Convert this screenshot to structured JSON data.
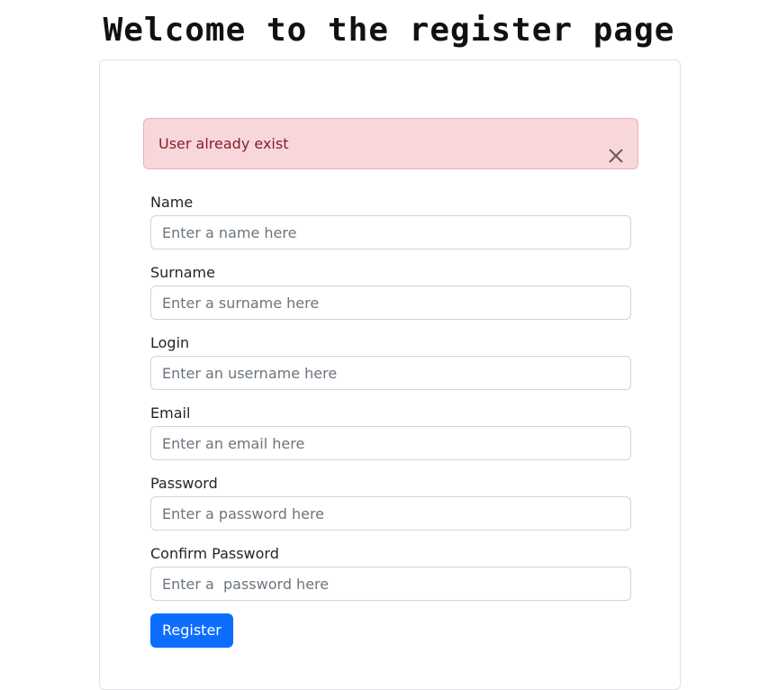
{
  "page": {
    "title": "Welcome to the register page"
  },
  "alert": {
    "message": "User already exist",
    "close_icon": "close-icon",
    "colors": {
      "background": "#f8d7da",
      "text": "#842029"
    }
  },
  "form": {
    "fields": [
      {
        "label": "Name",
        "placeholder": "Enter a name here",
        "value": ""
      },
      {
        "label": "Surname",
        "placeholder": "Enter a surname here",
        "value": ""
      },
      {
        "label": "Login",
        "placeholder": "Enter an username here",
        "value": ""
      },
      {
        "label": "Email",
        "placeholder": "Enter an email here",
        "value": ""
      },
      {
        "label": "Password",
        "placeholder": "Enter a password here",
        "value": ""
      },
      {
        "label": "Confirm Password",
        "placeholder": "Enter a  password here",
        "value": ""
      }
    ],
    "submit_label": "Register",
    "accent_color": "#0d6efd"
  }
}
